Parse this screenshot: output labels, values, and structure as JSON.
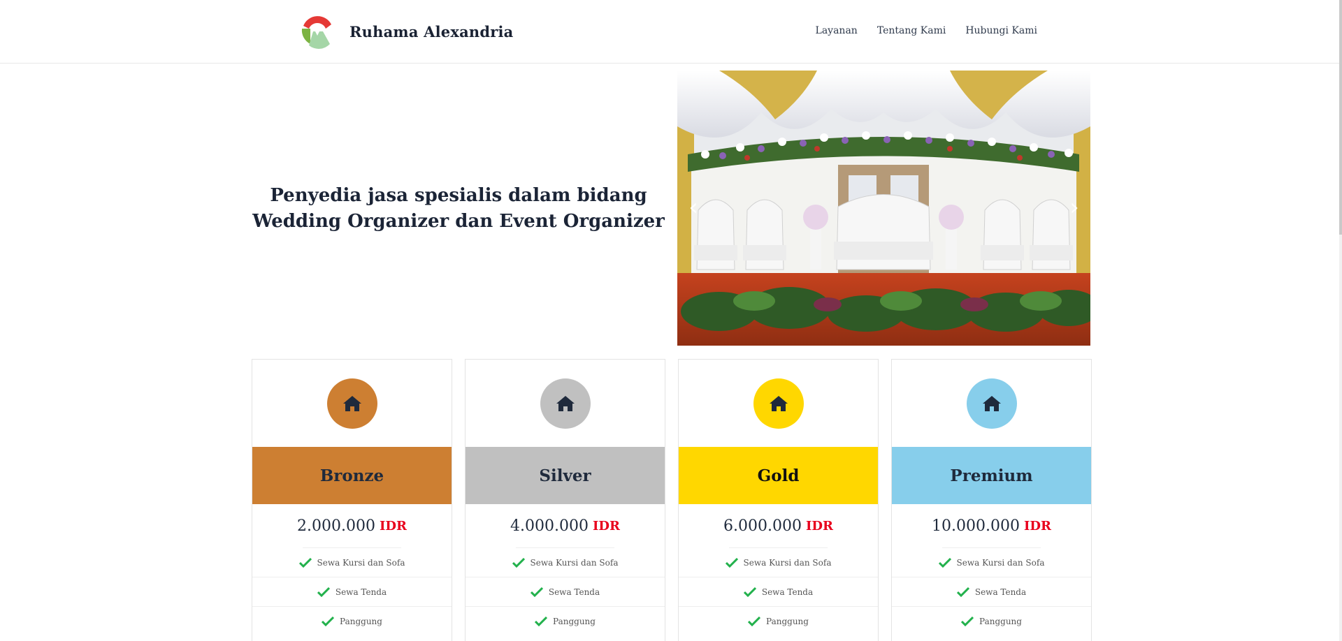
{
  "header": {
    "brand": "Ruhama Alexandria",
    "nav": [
      {
        "label": "Layanan"
      },
      {
        "label": "Tentang Kami"
      },
      {
        "label": "Hubungi Kami"
      }
    ]
  },
  "hero": {
    "headline": "Penyedia jasa spesialis dalam bidang Wedding Organizer dan Event Organizer",
    "carousel": {
      "prev_icon": "chevron-left-icon",
      "next_icon": "chevron-right-icon"
    }
  },
  "pricing": [
    {
      "name": "Bronze",
      "price": "2.000.000",
      "currency": "IDR",
      "color": "#cd7f32",
      "icon": "home-icon",
      "features": [
        "Sewa Kursi dan Sofa",
        "Sewa Tenda",
        "Panggung"
      ]
    },
    {
      "name": "Silver",
      "price": "4.000.000",
      "currency": "IDR",
      "color": "#c0c0c0",
      "icon": "home-icon",
      "features": [
        "Sewa Kursi dan Sofa",
        "Sewa Tenda",
        "Panggung"
      ]
    },
    {
      "name": "Gold",
      "price": "6.000.000",
      "currency": "IDR",
      "color": "#ffd700",
      "icon": "home-icon",
      "features": [
        "Sewa Kursi dan Sofa",
        "Sewa Tenda",
        "Panggung"
      ]
    },
    {
      "name": "Premium",
      "price": "10.000.000",
      "currency": "IDR",
      "color": "#87ceeb",
      "icon": "home-icon",
      "features": [
        "Sewa Kursi dan Sofa",
        "Sewa Tenda",
        "Panggung"
      ]
    }
  ],
  "colors": {
    "currency": "#e8001c",
    "check": "#22b14c",
    "text": "#1f2a3c"
  }
}
